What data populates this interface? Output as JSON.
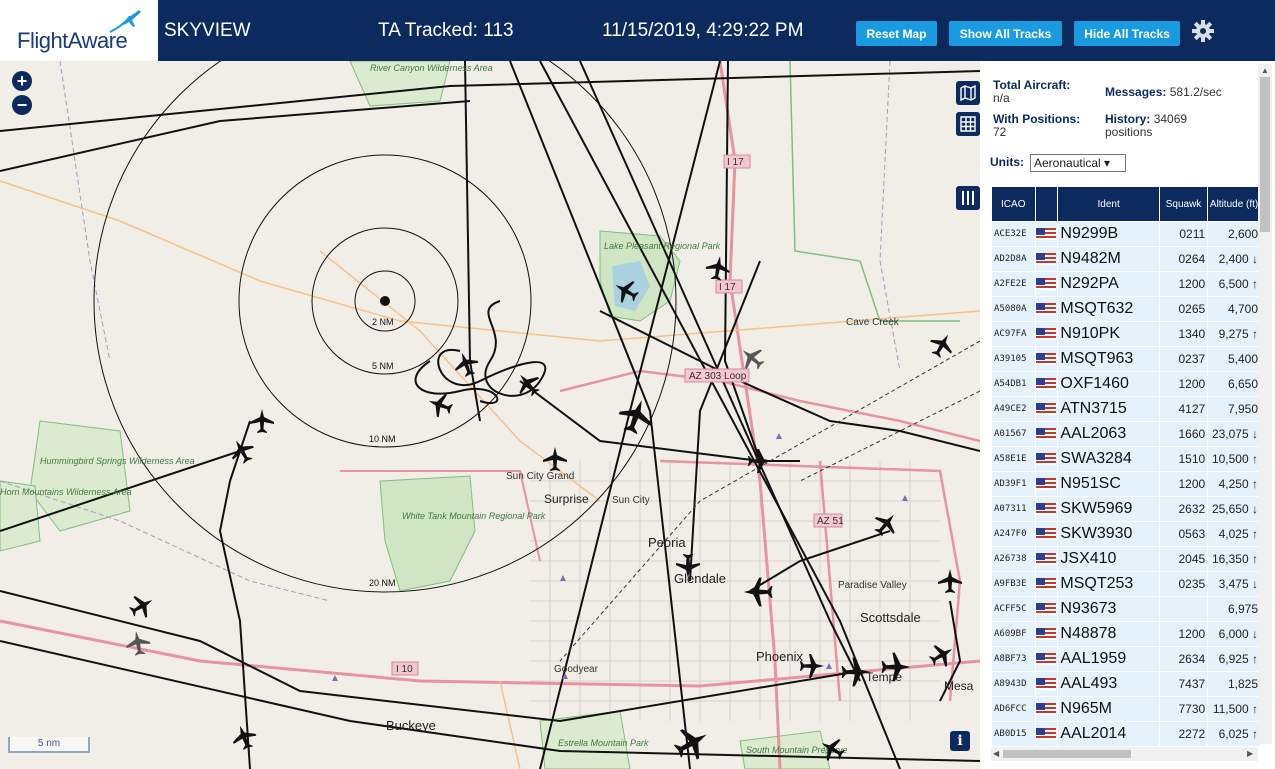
{
  "header": {
    "logo_text": "FlightAware",
    "title": "SKYVIEW",
    "tracked": "TA Tracked: 113",
    "datetime": "11/15/2019, 4:29:22 PM",
    "buttons": {
      "reset": "Reset Map",
      "show": "Show All Tracks",
      "hide": "Hide All Tracks"
    },
    "settings_icon": "gear-icon"
  },
  "map": {
    "zoom_in": "+",
    "zoom_out": "−",
    "scale": "5 nm",
    "range_labels": [
      "2 NM",
      "5 NM",
      "10 NM",
      "20 NM"
    ],
    "places": [
      "River Canyon Wilderness Area",
      "Lake Pleasant Regional Park",
      "Cave Creek",
      "Hummingbird Springs Wilderness Area",
      "Horn Mountains Wilderness Area",
      "White Tank Mountain Regional Park",
      "Sun City Grand",
      "Surprise",
      "Sun City",
      "Peoria",
      "Glendale",
      "Paradise Valley",
      "Scottsdale",
      "Phoenix",
      "Goodyear",
      "Buckeye",
      "Estrella Mountain Park",
      "South Mountain Preserve",
      "Tempe",
      "Mesa"
    ],
    "highways": [
      "I 17",
      "I 17",
      "AZ 303 Loop",
      "AZ 51",
      "I 10"
    ],
    "colors": {
      "land": "#f1eee8",
      "road_major": "#e892a2",
      "road_minor": "#f6c38a",
      "park_border": "#7fbf7f",
      "aircraft": "#111111",
      "brand": "#0c2a5e",
      "button": "#1a9be0"
    }
  },
  "sidebar": {
    "total_aircraft_label": "Total Aircraft:",
    "total_aircraft_value": "n/a",
    "with_positions_label": "With Positions:",
    "with_positions_value": "72",
    "messages_label": "Messages:",
    "messages_value": "581.2/sec",
    "history_label": "History:",
    "history_value": "34069",
    "history_unit": "positions",
    "units_label": "Units:",
    "units_value": "Aeronautical ▾",
    "columns": [
      "ICAO",
      "",
      "Ident",
      "Squawk",
      "Altitude (ft)"
    ],
    "rows": [
      {
        "icao": "ACE32E",
        "ident": "N9299B",
        "squawk": "0211",
        "alt": "2,600"
      },
      {
        "icao": "AD2D8A",
        "ident": "N9482M",
        "squawk": "0264",
        "alt": "2,400 ↓"
      },
      {
        "icao": "A2FE2E",
        "ident": "N292PA",
        "squawk": "1200",
        "alt": "6,500 ↑"
      },
      {
        "icao": "A5080A",
        "ident": "MSQT632",
        "squawk": "0265",
        "alt": "4,700"
      },
      {
        "icao": "AC97FA",
        "ident": "N910PK",
        "squawk": "1340",
        "alt": "9,275 ↑"
      },
      {
        "icao": "A39105",
        "ident": "MSQT963",
        "squawk": "0237",
        "alt": "5,400"
      },
      {
        "icao": "A54DB1",
        "ident": "OXF1460",
        "squawk": "1200",
        "alt": "6,650"
      },
      {
        "icao": "A49CE2",
        "ident": "ATN3715",
        "squawk": "4127",
        "alt": "7,950"
      },
      {
        "icao": "A01567",
        "ident": "AAL2063",
        "squawk": "1660",
        "alt": "23,075 ↓"
      },
      {
        "icao": "A58E1E",
        "ident": "SWA3284",
        "squawk": "1510",
        "alt": "10,500 ↑"
      },
      {
        "icao": "AD39F1",
        "ident": "N951SC",
        "squawk": "1200",
        "alt": "4,250 ↑"
      },
      {
        "icao": "A07311",
        "ident": "SKW5969",
        "squawk": "2632",
        "alt": "25,650 ↓"
      },
      {
        "icao": "A247F0",
        "ident": "SKW3930",
        "squawk": "0563",
        "alt": "4,025 ↑"
      },
      {
        "icao": "A26738",
        "ident": "JSX410",
        "squawk": "2045",
        "alt": "16,350 ↑"
      },
      {
        "icao": "A9FB3E",
        "ident": "MSQT253",
        "squawk": "0235",
        "alt": "3,475 ↓"
      },
      {
        "icao": "ACFF5C",
        "ident": "N93673",
        "squawk": "",
        "alt": "6,975"
      },
      {
        "icao": "A609BF",
        "ident": "N48878",
        "squawk": "1200",
        "alt": "6,000 ↓"
      },
      {
        "icao": "A8BF73",
        "ident": "AAL1959",
        "squawk": "2634",
        "alt": "6,925 ↑"
      },
      {
        "icao": "A8943D",
        "ident": "AAL493",
        "squawk": "7437",
        "alt": "1,825"
      },
      {
        "icao": "AD6FCC",
        "ident": "N965M",
        "squawk": "7730",
        "alt": "11,500 ↑"
      },
      {
        "icao": "AB0D15",
        "ident": "AAL2014",
        "squawk": "2272",
        "alt": "6,025 ↑"
      }
    ]
  }
}
